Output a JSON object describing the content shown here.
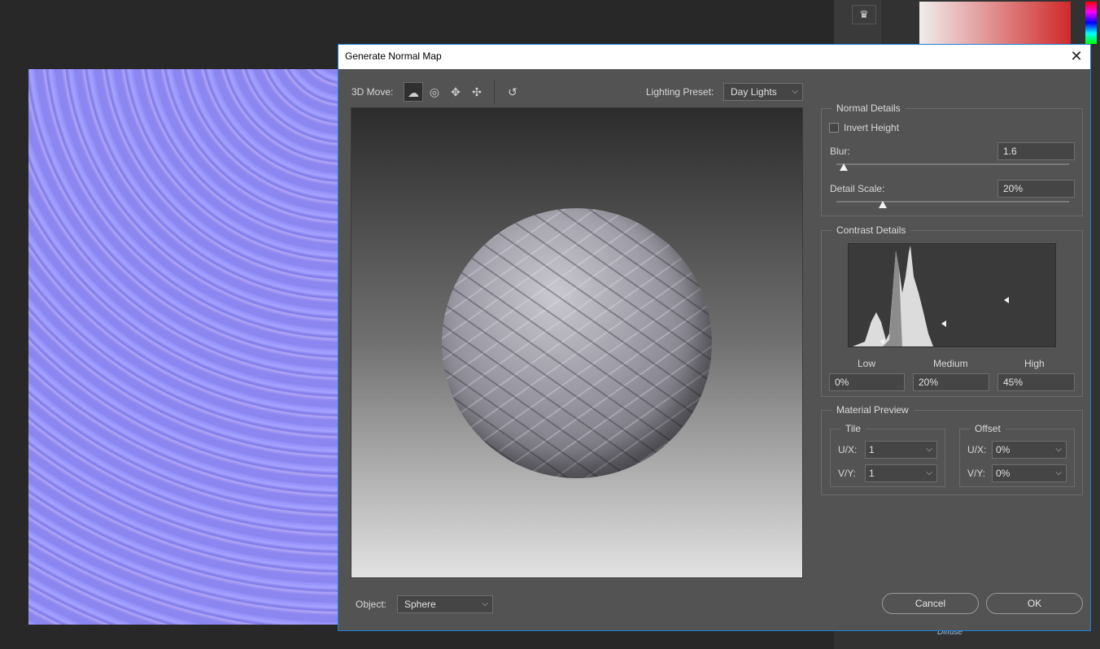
{
  "dialog": {
    "title": "Generate Normal Map",
    "close_glyph": "✕"
  },
  "toolbar": {
    "move_label": "3D Move:",
    "tools": [
      "orbit-icon",
      "rotate-icon",
      "pan-icon",
      "drag-icon"
    ],
    "reset_icon": "undo-icon",
    "lighting_label": "Lighting Preset:",
    "lighting_value": "Day Lights"
  },
  "normal_details": {
    "title": "Normal Details",
    "invert_label": "Invert Height",
    "invert_checked": false,
    "blur_label": "Blur:",
    "blur_value": "1.6",
    "blur_level": 0.03,
    "detail_label": "Detail Scale:",
    "detail_value": "20%",
    "detail_level": 0.2
  },
  "contrast_details": {
    "title": "Contrast Details",
    "low_label": "Low",
    "medium_label": "Medium",
    "high_label": "High",
    "low_value": "0%",
    "medium_value": "20%",
    "high_value": "45%"
  },
  "material_preview": {
    "title": "Material Preview",
    "tile_label": "Tile",
    "offset_label": "Offset",
    "ux_label": "U/X:",
    "vy_label": "V/Y:",
    "tile_ux": "1",
    "tile_vy": "1",
    "offset_ux": "0%",
    "offset_vy": "0%"
  },
  "object": {
    "label": "Object:",
    "value": "Sphere"
  },
  "buttons": {
    "cancel": "Cancel",
    "ok": "OK"
  },
  "background": {
    "layer_label": "Diffuse"
  },
  "colors": {
    "dialog_bg": "#535353",
    "title_bar": "#ffffff",
    "accent_border": "#1f7fd6",
    "normal_map": "#8a86f0"
  }
}
